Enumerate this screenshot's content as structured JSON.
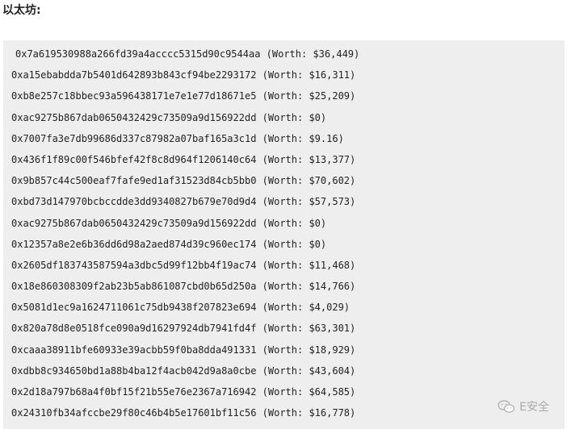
{
  "heading": "以太坊:",
  "lines": [
    "0x7a619530988a266fd39a4acccc5315d90c9544aa (Worth: $36,449)",
    "0xa15ebabdda7b5401d642893b843cf94be2293172 (Worth: $16,311)",
    "0xb8e257c18bbec93a596438171e7e1e77d18671e5 (Worth: $25,209)",
    "0xac9275b867dab0650432429c73509a9d156922dd (Worth: $0)",
    "0x7007fa3e7db99686d337c87982a07baf165a3c1d (Worth: $9.16)",
    "0x436f1f89c00f546bfef42f8c8d964f1206140c64 (Worth: $13,377)",
    "0x9b857c44c500eaf7fafe9ed1af31523d84cb5bb0 (Worth: $70,602)",
    "0xbd73d147970bcbccdde3dd9340827b679e70d9d4 (Worth: $57,573)",
    "0xac9275b867dab0650432429c73509a9d156922dd (Worth: $0)",
    "0x12357a8e2e6b36dd6d98a2aed874d39c960ec174 (Worth: $0)",
    "0x2605df183743587594a3dbc5d99f12bb4f19ac74 (Worth: $11,468)",
    "0x18e860308309f2ab23b5ab861087cbd0b65d250a (Worth: $14,766)",
    "0x5081d1ec9a1624711061c75db9438f207823e694 (Worth: $4,029)",
    "0x820a78d8e0518fce090a9d16297924db7941fd4f (Worth: $63,301)",
    "0xcaaa38911bfe60933e39acbb59f0ba8dda491331 (Worth: $18,929)",
    "0xdbb8c934650bd1a88b4ba12f4acb042d9a8a0cbe (Worth: $43,604)",
    "0x2d18a797b68a4f0bf15f21b55e76e2367a716942 (Worth: $64,585)",
    "0x24310fb34afccbe29f80c46b4b5e17601bf11c56 (Worth: $16,778)"
  ],
  "watermark": {
    "icon": "wechat-icon",
    "text": "E安全"
  }
}
